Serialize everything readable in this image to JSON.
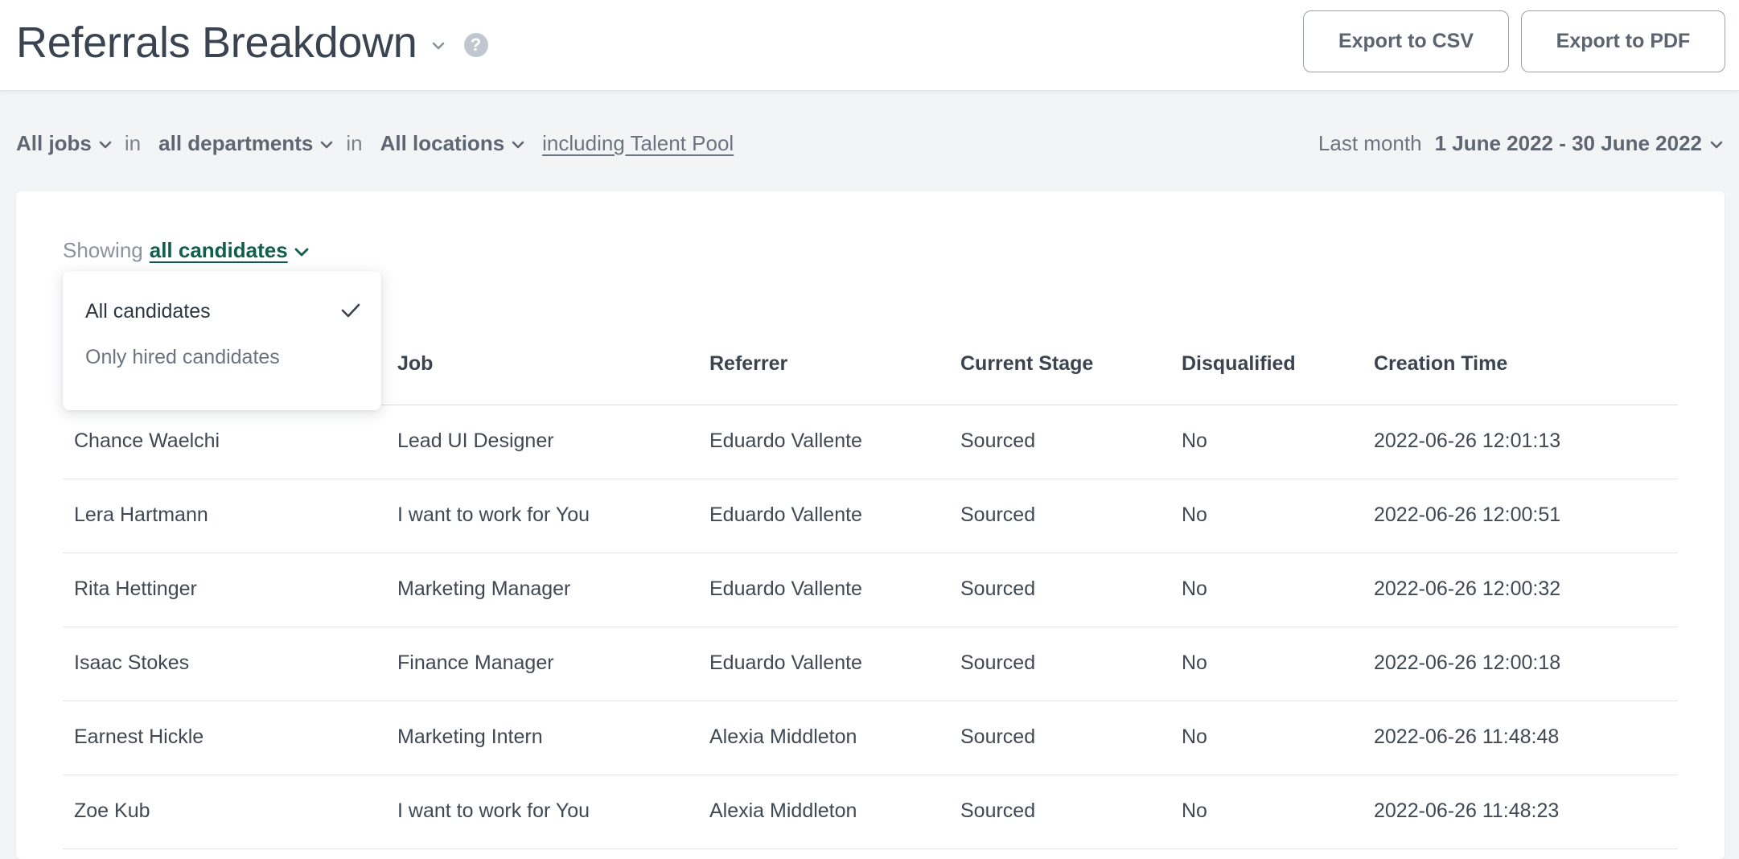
{
  "header": {
    "title": "Referrals Breakdown",
    "help_glyph": "?",
    "export_csv_label": "Export to CSV",
    "export_pdf_label": "Export to PDF"
  },
  "filters": {
    "jobs": "All jobs",
    "sep1": "in",
    "departments": "all departments",
    "sep2": "in",
    "locations": "All locations",
    "talent_pool": "including Talent Pool",
    "date_label": "Last month",
    "date_value": "1 June 2022 - 30 June 2022"
  },
  "showing": {
    "label": "Showing",
    "value": "all candidates"
  },
  "dropdown": {
    "options": [
      {
        "label": "All candidates",
        "selected": true
      },
      {
        "label": "Only hired candidates",
        "selected": false
      }
    ]
  },
  "table": {
    "columns": [
      "Job",
      "Referrer",
      "Current Stage",
      "Disqualified",
      "Creation Time"
    ],
    "rows": [
      {
        "candidate": "Chance Waelchi",
        "job": "Lead UI Designer",
        "referrer": "Eduardo Vallente",
        "stage": "Sourced",
        "disqualified": "No",
        "created": "2022-06-26 12:01:13"
      },
      {
        "candidate": "Lera Hartmann",
        "job": "I want to work for You",
        "referrer": "Eduardo Vallente",
        "stage": "Sourced",
        "disqualified": "No",
        "created": "2022-06-26 12:00:51"
      },
      {
        "candidate": "Rita Hettinger",
        "job": "Marketing Manager",
        "referrer": "Eduardo Vallente",
        "stage": "Sourced",
        "disqualified": "No",
        "created": "2022-06-26 12:00:32"
      },
      {
        "candidate": "Isaac Stokes",
        "job": "Finance Manager",
        "referrer": "Eduardo Vallente",
        "stage": "Sourced",
        "disqualified": "No",
        "created": "2022-06-26 12:00:18"
      },
      {
        "candidate": "Earnest Hickle",
        "job": "Marketing Intern",
        "referrer": "Alexia Middleton",
        "stage": "Sourced",
        "disqualified": "No",
        "created": "2022-06-26 11:48:48"
      },
      {
        "candidate": "Zoe Kub",
        "job": "I want to work for You",
        "referrer": "Alexia Middleton",
        "stage": "Sourced",
        "disqualified": "No",
        "created": "2022-06-26 11:48:23"
      }
    ]
  },
  "icons": {
    "title_chevron": "chevron-down-icon",
    "help": "help-icon",
    "filter_chevron": "chevron-down-icon",
    "check": "check-icon"
  },
  "colors": {
    "accent_green": "#0f5f4c",
    "text_dark": "#2d3742",
    "text_muted": "#6b7480",
    "background": "#f3f4f5"
  }
}
